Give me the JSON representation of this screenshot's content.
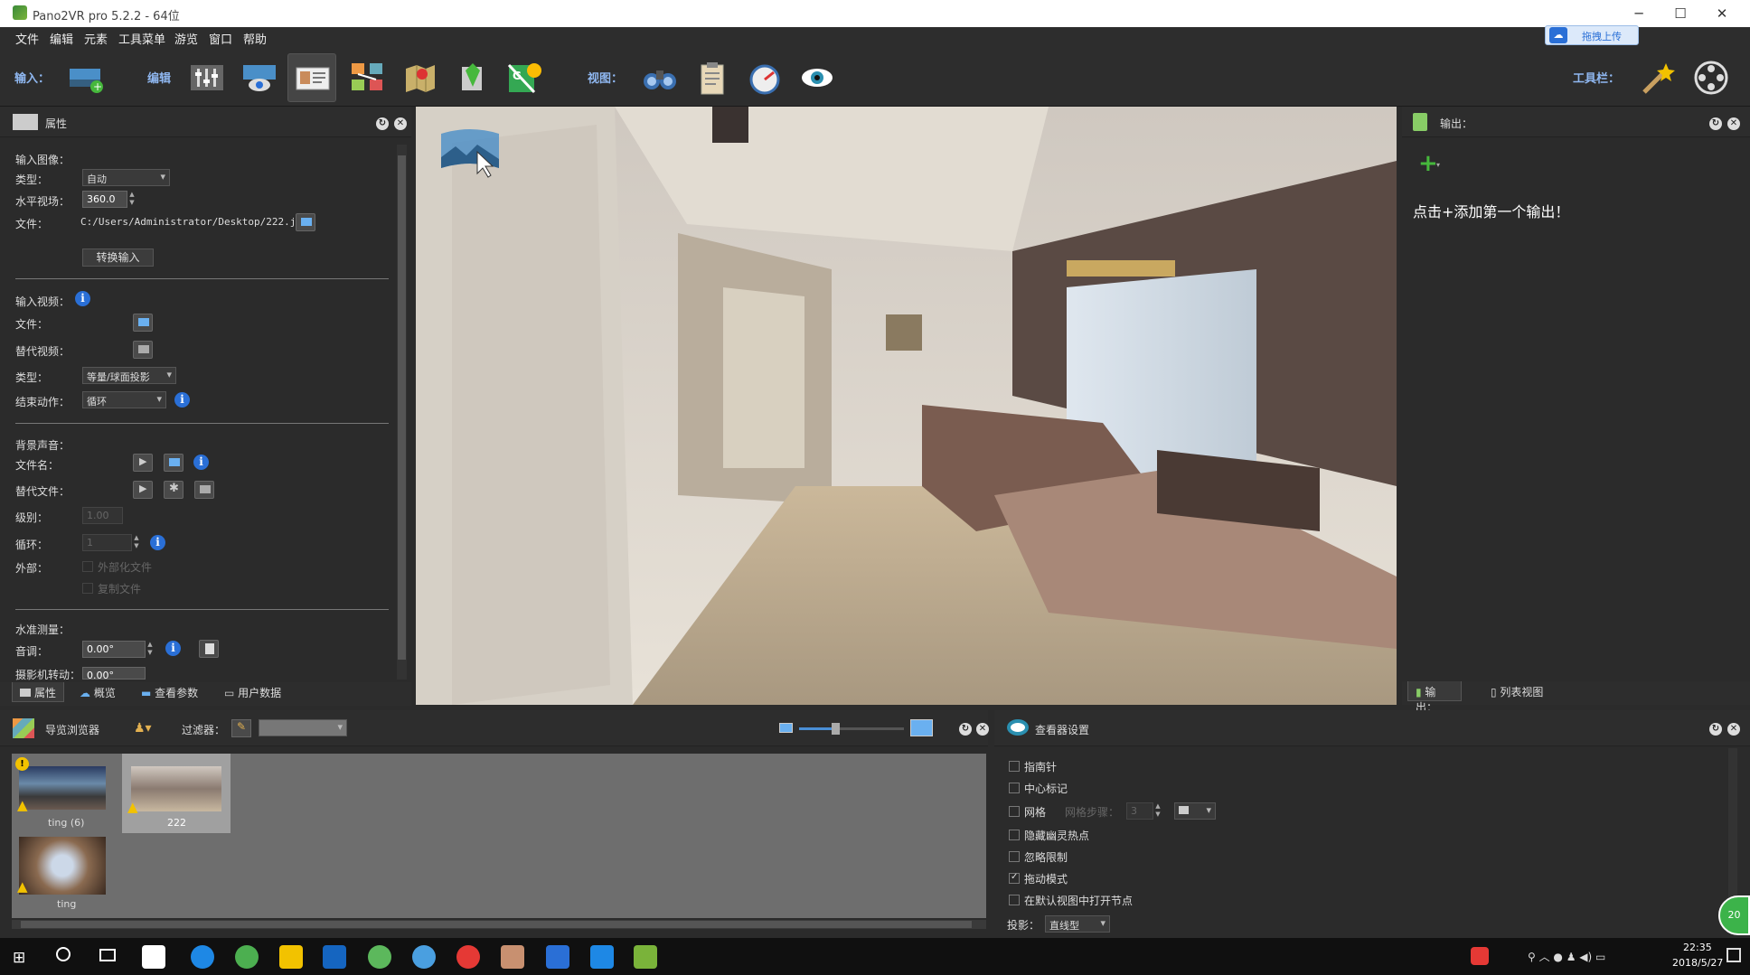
{
  "window": {
    "title": "Pano2VR pro 5.2.2 - 64位",
    "upload_label": "拖拽上传"
  },
  "menu": [
    "文件",
    "编辑",
    "元素",
    "工具菜单",
    "游览",
    "窗口",
    "帮助"
  ],
  "toolbar": {
    "input_label": "输入：",
    "edit_label": "编辑",
    "view_label": "视图：",
    "tools_label": "工具栏："
  },
  "properties": {
    "title": "属性",
    "input_image_section": "输入图像：",
    "type_label": "类型：",
    "type_value": "自动",
    "hfov_label": "水平视场：",
    "hfov_value": "360.0",
    "file_label": "文件：",
    "file_path": "C:/Users/Administrator/Desktop/222.jpg",
    "convert_button": "转换输入",
    "input_video_section": "输入视频：",
    "video_file_label": "文件：",
    "alt_video_label": "替代视频：",
    "video_type_label": "类型：",
    "video_type_value": "等量/球面投影",
    "end_action_label": "结束动作：",
    "end_action_value": "循环",
    "bg_sound_section": "背景声音：",
    "filename_label": "文件名：",
    "alt_file_label": "替代文件：",
    "level_label": "级别：",
    "level_value": "1.00",
    "loop_label": "循环：",
    "loop_value": "1",
    "external_label": "外部：",
    "externalize_label": "外部化文件",
    "copy_file_label": "复制文件",
    "leveling_section": "水准测量：",
    "pitch_label": "音调：",
    "pitch_value": "0.00°",
    "camera_roll_label": "摄影机转动：",
    "camera_roll_value": "0.00°"
  },
  "left_tabs": [
    "属性",
    "概览",
    "查看参数",
    "用户数据"
  ],
  "output": {
    "title": "输出：",
    "hint": "点击+添加第一个输出！",
    "tabs": [
      "输出：",
      "列表视图"
    ]
  },
  "tour_browser": {
    "title": "导览浏览器",
    "filter_label": "过滤器：",
    "nodes": [
      {
        "label": "ting (6)",
        "warn_top": true
      },
      {
        "label": "222",
        "warn_top": false
      },
      {
        "label": "ting",
        "warn_top": false
      }
    ]
  },
  "viewer_settings": {
    "title": "查看器设置",
    "compass_label": "指南针",
    "center_mark_label": "中心标记",
    "grid_label": "网格",
    "grid_step_label": "网格步骤：",
    "grid_step_value": "3",
    "hide_hotspots_label": "隐藏幽灵热点",
    "ignore_limits_label": "忽略限制",
    "drag_mode_label": "拖动模式",
    "open_default_label": "在默认视图中打开节点",
    "projection_label": "投影：",
    "projection_value": "直线型"
  },
  "taskbar": {
    "time": "22:35",
    "date": "2018/5/27",
    "badge": "20"
  },
  "colors": {
    "accent_blue": "#2a6fd6",
    "label_blue": "#8fb7f0",
    "warning": "#f2c200",
    "plus_green": "#46b83c"
  }
}
